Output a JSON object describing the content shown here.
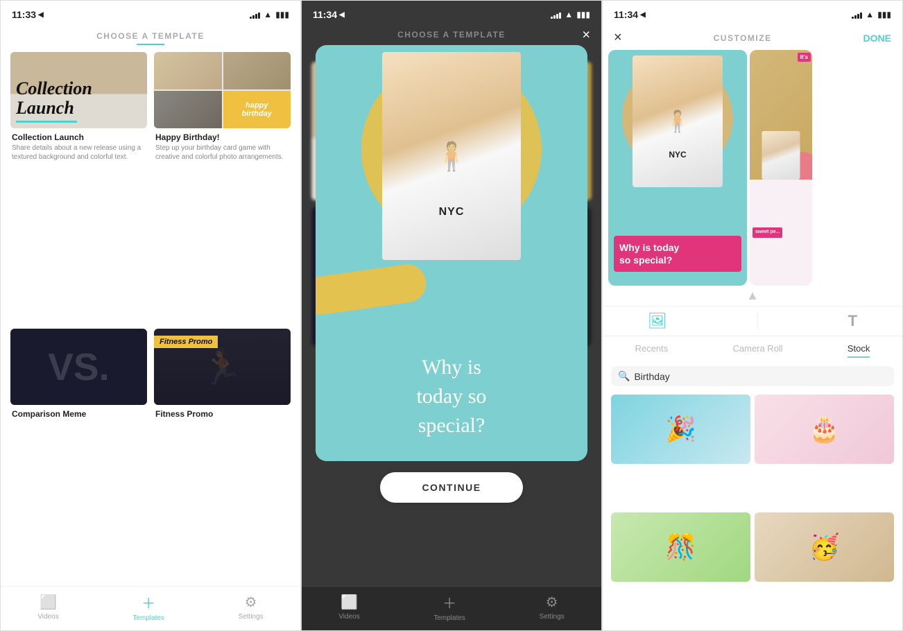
{
  "phone1": {
    "status": {
      "time": "11:33",
      "location_icon": "◀",
      "signal": [
        3,
        5,
        7,
        9,
        11
      ],
      "wifi": "▲",
      "battery": "▮"
    },
    "title": "CHOOSE A TEMPLATE",
    "templates": [
      {
        "id": "collection-launch",
        "name": "Collection Launch",
        "description": "Share details about a new release using a textured background and colorful text.",
        "label": "Collection\nLaunch",
        "type": "collection"
      },
      {
        "id": "happy-birthday",
        "name": "Happy Birthday!",
        "description": "Step up your birthday card game with creative and colorful photo arrangements.",
        "label": "happy\nbirthday",
        "type": "birthday"
      },
      {
        "id": "comparison-meme",
        "name": "Comparison Meme",
        "description": "",
        "label": "VS.",
        "type": "vs"
      },
      {
        "id": "fitness-promo",
        "name": "Fitness Promo",
        "description": "",
        "label": "Fitness Promo",
        "type": "fitness"
      }
    ],
    "nav": {
      "items": [
        {
          "label": "Videos",
          "icon": "▶",
          "active": false
        },
        {
          "label": "Templates",
          "icon": "+",
          "active": true
        },
        {
          "label": "Settings",
          "icon": "⚙",
          "active": false
        }
      ]
    }
  },
  "phone2": {
    "status": {
      "time": "11:34",
      "location_icon": "◀"
    },
    "title": "CHOOSE A TEMPLATE",
    "close_label": "×",
    "preview": {
      "question": "Why is\ntoday so\nspecial?",
      "continue_label": "CONTINUE"
    },
    "nav": {
      "items": [
        {
          "label": "Videos",
          "icon": "▶"
        },
        {
          "label": "Templates",
          "icon": "+"
        },
        {
          "label": "Settings",
          "icon": "⚙"
        }
      ]
    }
  },
  "phone3": {
    "status": {
      "time": "11:34",
      "location_icon": "◀"
    },
    "close_label": "×",
    "title": "CUSTOMIZE",
    "done_label": "DONE",
    "preview": {
      "question": "Why is today\nso special?",
      "it_label": "It's",
      "sweet_label": "sweet pe..."
    },
    "tools": {
      "image_icon": "🖼",
      "text_icon": "T"
    },
    "tabs": [
      {
        "label": "Recents",
        "active": false
      },
      {
        "label": "Camera Roll",
        "active": false
      },
      {
        "label": "Stock",
        "active": true
      }
    ],
    "search": {
      "placeholder": "Birthday",
      "value": "Birthday"
    },
    "stock_images": [
      {
        "emoji": "🎉",
        "alt": "birthday party kid"
      },
      {
        "emoji": "🎂",
        "alt": "birthday candles cake"
      },
      {
        "emoji": "🎊",
        "alt": "birthday decorations"
      },
      {
        "emoji": "🥳",
        "alt": "birthday celebration"
      }
    ]
  }
}
